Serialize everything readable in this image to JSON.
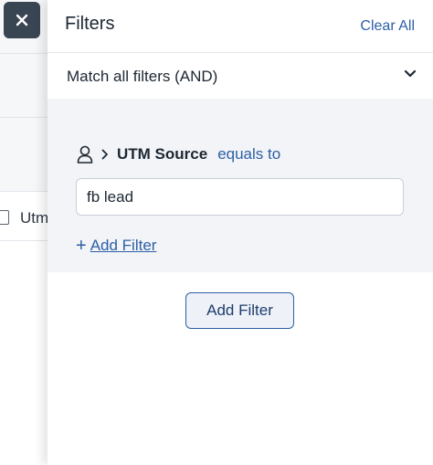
{
  "background": {
    "row_text": "Utm"
  },
  "close_icon": "close-icon",
  "panel": {
    "title": "Filters",
    "clear_all": "Clear All",
    "match_mode": "Match all filters (AND)",
    "condition": {
      "icon": "person-icon",
      "field": "UTM Source",
      "operator": "equals to",
      "value": "fb lead"
    },
    "add_filter_link": "Add Filter",
    "add_filter_link_prefix": "+",
    "add_filter_button": "Add Filter"
  },
  "colors": {
    "accent": "#2d5fa6",
    "close_button_bg": "#3a4553",
    "filter_box_bg": "#f2f4f7"
  }
}
